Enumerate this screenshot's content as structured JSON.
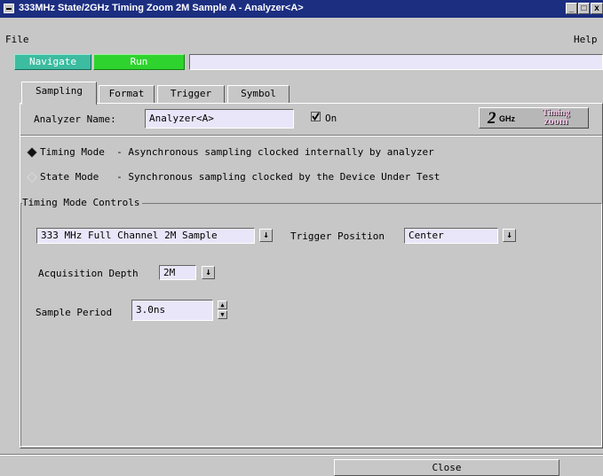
{
  "window": {
    "title": "333MHz State/2GHz Timing Zoom 2M Sample A - Analyzer<A>",
    "min_label": "_",
    "max_label": "□",
    "close_label": "x"
  },
  "menubar": {
    "file": "File",
    "help": "Help"
  },
  "toolbar": {
    "navigate": "Navigate",
    "run": "Run",
    "status": ""
  },
  "tabs": [
    {
      "label": "Sampling",
      "active": true
    },
    {
      "label": "Format",
      "active": false
    },
    {
      "label": "Trigger",
      "active": false
    },
    {
      "label": "Symbol",
      "active": false
    }
  ],
  "sampling": {
    "analyzer_name_label": "Analyzer Name:",
    "analyzer_name_value": "Analyzer<A>",
    "on_label": "On",
    "on_checked": true,
    "logo": {
      "two": "2",
      "ghz": "GHz",
      "timing": "Timing",
      "zoom": "zoom"
    },
    "modes": [
      {
        "label": "Timing Mode  - Asynchronous sampling clocked internally by analyzer",
        "selected": true
      },
      {
        "label": "State Mode   - Synchronous sampling clocked by the Device Under Test",
        "selected": false
      }
    ],
    "group_title": "Timing Mode Controls",
    "sample_mode_value": "333 MHz Full Channel 2M Sample",
    "trigger_position_label": "Trigger Position",
    "trigger_position_value": "Center",
    "acquisition_depth_label": "Acquisition Depth",
    "acquisition_depth_value": "2M",
    "sample_period_label": "Sample Period",
    "sample_period_value": "3.0ns"
  },
  "footer": {
    "close": "Close"
  },
  "colors": {
    "titlebar": "#1c2e80",
    "navigate": "#3cbca0",
    "run": "#2ed32e",
    "field": "#e8e6f8",
    "window": "#c7c7c7"
  }
}
